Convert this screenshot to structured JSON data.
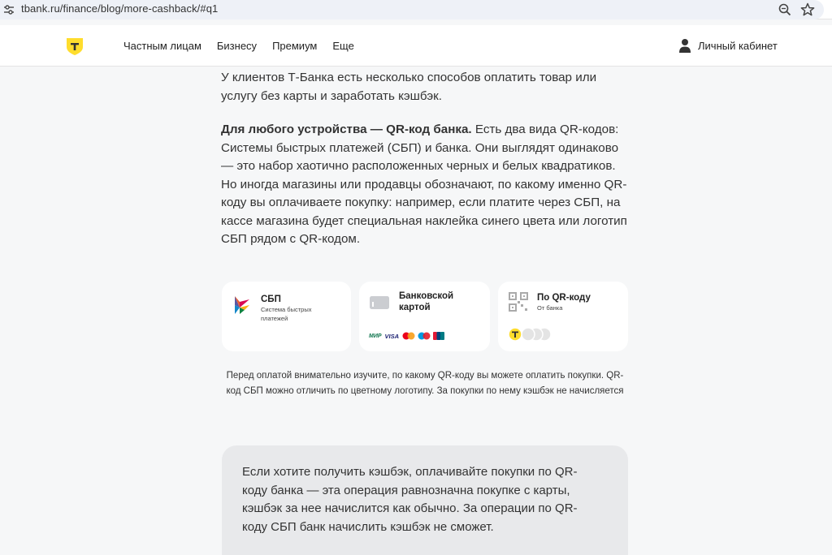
{
  "browser": {
    "url": "tbank.ru/finance/blog/more-cashback/#q1",
    "icons": [
      "tune-icon",
      "zoom-icon",
      "star-icon"
    ]
  },
  "header": {
    "nav": [
      "Частным лицам",
      "Бизнесу",
      "Премиум",
      "Еще"
    ],
    "account_label": "Личный кабинет",
    "logo_color": "#ffdd2d"
  },
  "article": {
    "intro": "У клиентов Т-Банка есть несколько способов оплатить товар или услугу без карты и заработать кэшбэк.",
    "qr_heading": "Для любого устройства — QR-код банка.",
    "qr_text": "Есть два вида QR-кодов: Системы быстрых платежей (СБП) и банка. Они выглядят одинаково — это набор хаотично расположенных черных и белых квадратиков. Но иногда магазины или продавцы обозначают, по какому именно QR-коду вы оплачиваете покупку: например, если платите через СБП, на кассе магазина будет специальная наклейка синего цвета или логотип СБП рядом с QR-кодом."
  },
  "cards": {
    "sbp": {
      "title": "СБП",
      "subtitle": "Система быстрых платежей"
    },
    "bank_card": {
      "title": "Банковской картой",
      "brands": [
        "МИР",
        "VISA",
        "mastercard",
        "maestro",
        "UnionPay"
      ]
    },
    "qr": {
      "title": "По QR-коду",
      "subtitle": "От банка"
    }
  },
  "caption": "Перед оплатой внимательно изучите, по какому QR-коду вы можете оплатить покупки. QR-код СБП можно отличить по цветному логотипу. За покупки по нему кэшбэк не начисляется",
  "note": "Если хотите получить кэшбэк, оплачивайте покупки по QR-коду банка — эта операция равнозначна покупке с карты, кэшбэк за нее начислится как обычно. За операции по QR-коду СБП банк начислить кэшбэк не сможет."
}
